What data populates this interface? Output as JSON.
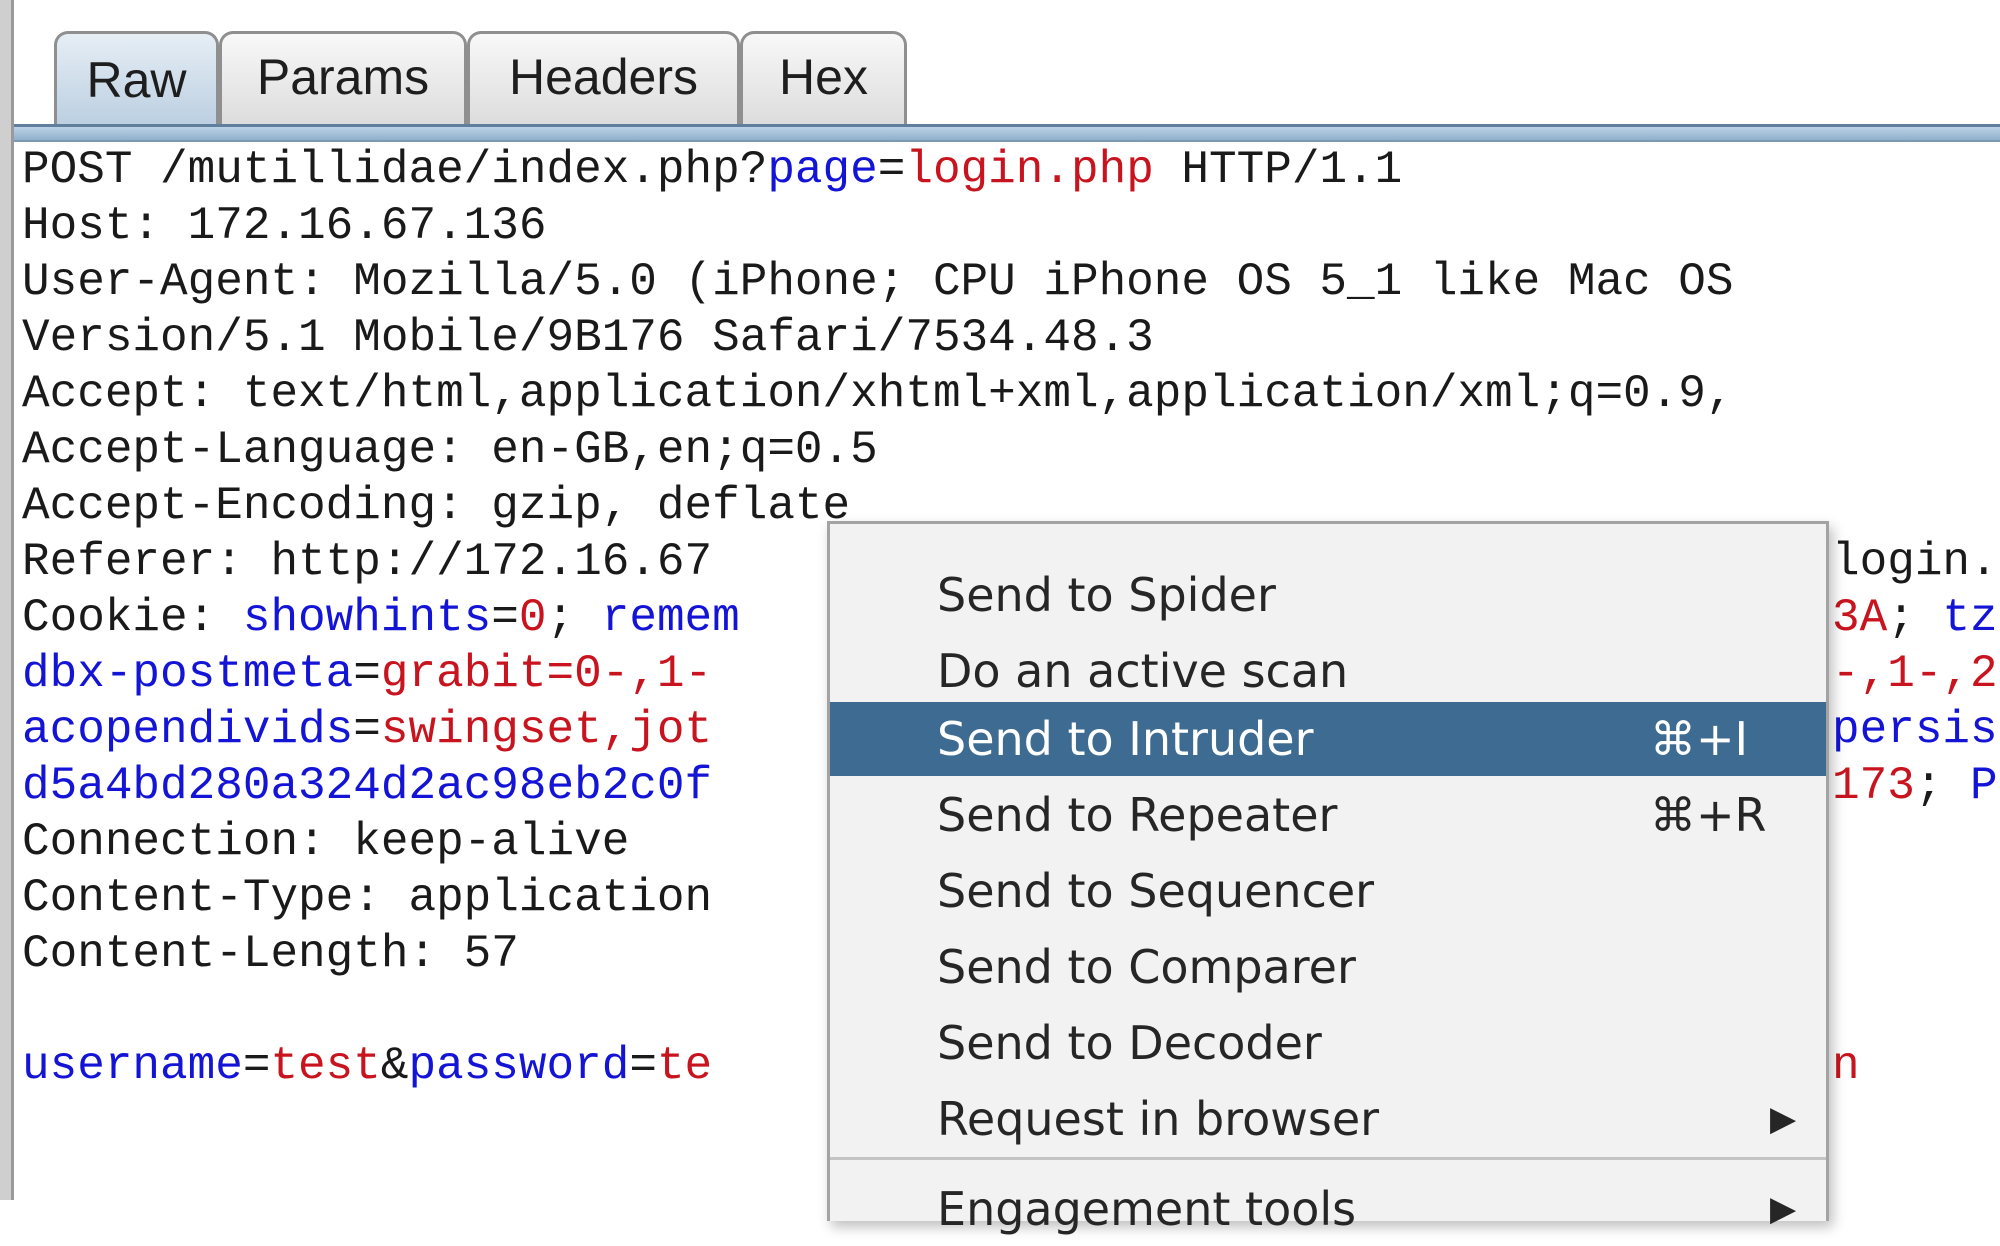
{
  "tabs": [
    {
      "label": "Raw",
      "active": true
    },
    {
      "label": "Params",
      "active": false
    },
    {
      "label": "Headers",
      "active": false
    },
    {
      "label": "Hex",
      "active": false
    }
  ],
  "request": {
    "l1": {
      "a": "POST /mutillidae/index.php?",
      "k": "page",
      "eq": "=",
      "v": "login.php",
      "b": " HTTP/1.1"
    },
    "l2": "Host: 172.16.67.136",
    "l3": "User-Agent: Mozilla/5.0 (iPhone; CPU iPhone OS 5_1 like Mac OS",
    "l4": "Version/5.1 Mobile/9B176 Safari/7534.48.3",
    "l5": "Accept: text/html,application/xhtml+xml,application/xml;q=0.9,",
    "l6": "Accept-Language: en-GB,en;q=0.5",
    "l7": "Accept-Encoding: gzip, deflate",
    "l8": {
      "a": "Referer: http://172.16.67",
      "tail": "login."
    },
    "l9": {
      "a": "Cookie: ",
      "k1": "showhints",
      "eq1": "=",
      "v1": "0",
      "sc1": "; ",
      "k2": "remem",
      "tail_v": "3A",
      "tail_sc": "; ",
      "tail_k": "tz"
    },
    "l10": {
      "k": "dbx-postmeta",
      "eq": "=",
      "v": "grabit=0-,1-",
      "tail_v": "-,1-,2"
    },
    "l11": {
      "k": "acopendivids",
      "eq": "=",
      "v": "swingset,jot",
      "tail_k": "persis"
    },
    "l12": {
      "k": "d5a4bd280a324d2ac98eb2c0f",
      "tail_v": "173",
      "tail_sc": "; ",
      "tail_k": "P"
    },
    "l13": "Connection: keep-alive",
    "l14": "Content-Type: application",
    "l15": "Content-Length: 57",
    "body": {
      "k1": "username",
      "eq1": "=",
      "v1": "test",
      "amp": "&",
      "k2": "password",
      "eq2": "=",
      "v2": "te",
      "tail_v": "n"
    }
  },
  "context_menu": {
    "items": [
      {
        "label": "Send to Spider",
        "shortcut": ""
      },
      {
        "label": "Do an active scan",
        "shortcut": ""
      },
      {
        "label": "Send to Intruder",
        "shortcut": "⌘+I"
      },
      {
        "label": "Send to Repeater",
        "shortcut": "⌘+R"
      },
      {
        "label": "Send to Sequencer",
        "shortcut": ""
      },
      {
        "label": "Send to Comparer",
        "shortcut": ""
      },
      {
        "label": "Send to Decoder",
        "shortcut": ""
      },
      {
        "label": "Request in browser",
        "shortcut": "",
        "submenu_glyph": "▶"
      },
      {
        "label": "Engagement tools",
        "shortcut": "",
        "submenu_glyph": "▶"
      }
    ],
    "highlighted_index": 2
  },
  "colors": {
    "param_name": "#1414d6",
    "param_value": "#c8141e",
    "menu_highlight": "#3d6b91"
  }
}
